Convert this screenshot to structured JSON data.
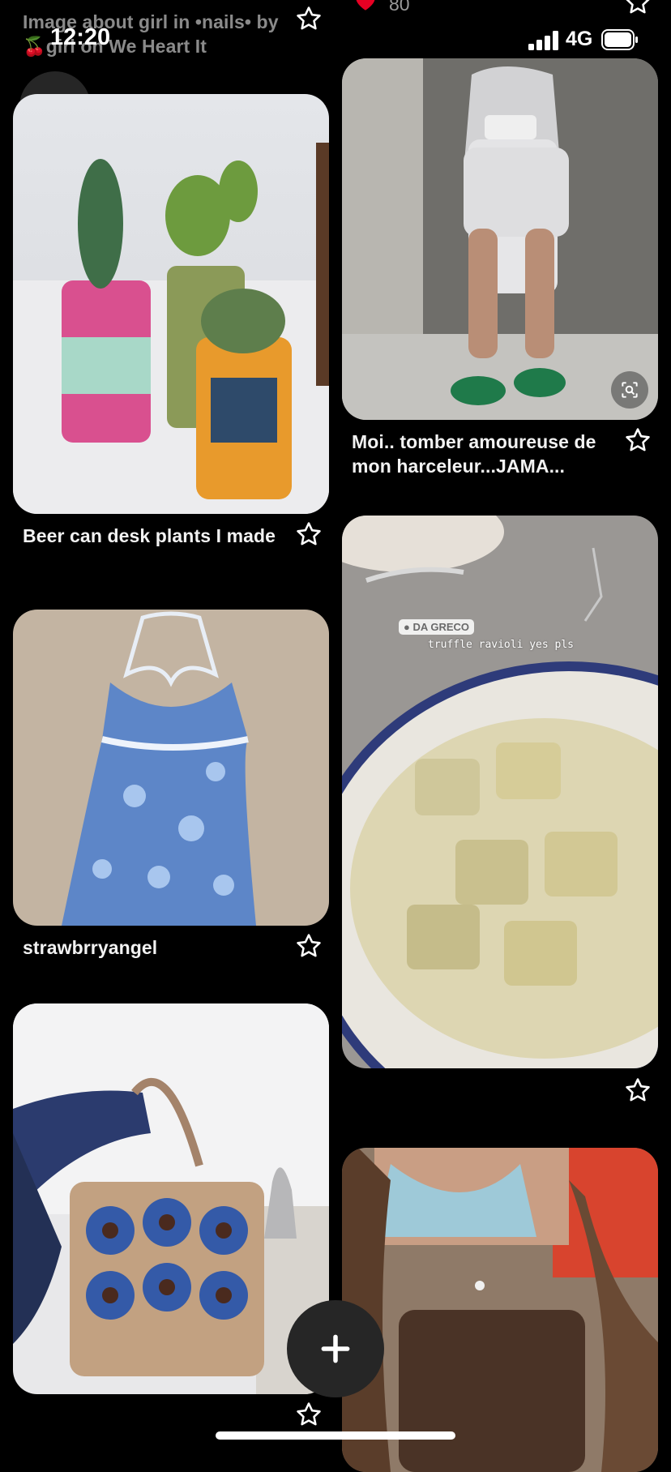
{
  "status_bar": {
    "time": "12:20",
    "network": "4G"
  },
  "top_pin_caption": "Image about girl in •nails• by 🍒girl on We Heart It",
  "top_likes": "80",
  "left_column": [
    {
      "caption": "Beer can desk plants I made"
    },
    {
      "caption": "strawbrryangel"
    },
    {
      "caption": ""
    }
  ],
  "right_column": [
    {
      "caption": "Moi.. tomber amoureuse de mon harceleur...JAMA..."
    },
    {
      "caption": "",
      "story_location": "DA GRECO",
      "story_text": "truffle ravioli yes pls"
    },
    {
      "caption": ""
    }
  ],
  "colors": {
    "background": "#000000",
    "button": "#262626",
    "heart": "#e60023"
  }
}
